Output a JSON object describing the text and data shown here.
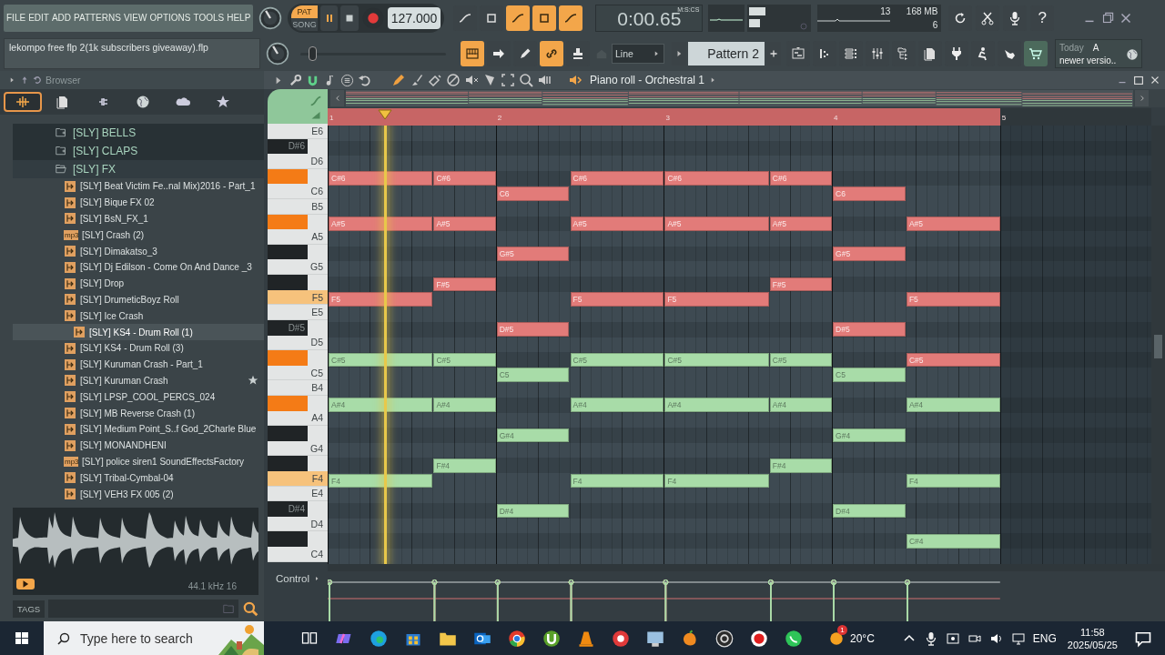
{
  "menu": [
    "FILE",
    "EDIT",
    "ADD",
    "PATTERNS",
    "VIEW",
    "OPTIONS",
    "TOOLS",
    "HELP"
  ],
  "project_title": "lekompo free flp 2(1k subscribers giveaway).flp",
  "transport": {
    "modes": [
      {
        "label": "PAT",
        "selected": true
      },
      {
        "label": "SONG",
        "selected": false
      }
    ],
    "tempo": "127.000"
  },
  "time_display": {
    "value": "0:00.65",
    "format": "M:S:CS"
  },
  "monitor": {
    "cpu": "13",
    "memory": "168 MB",
    "polyphony": "6"
  },
  "help_button": "?",
  "master_pitch": {
    "level": 0.08
  },
  "snap": "Line",
  "pattern": "Pattern 2",
  "news": {
    "date": "Today",
    "lines": [
      "A",
      "newer versio.."
    ]
  },
  "browser": {
    "title": "Browser",
    "tabs": [
      {
        "kind": "all",
        "selected": true
      },
      {
        "kind": "files",
        "selected": false
      },
      {
        "kind": "plugins",
        "selected": false
      },
      {
        "kind": "world",
        "selected": false
      },
      {
        "kind": "cloud",
        "selected": false
      },
      {
        "kind": "favorites",
        "selected": false
      }
    ],
    "tree": [
      {
        "label": "[SLY] BELLS",
        "expanded": false
      },
      {
        "label": "[SLY] CLAPS",
        "expanded": false
      },
      {
        "label": "[SLY] FX",
        "expanded": true,
        "children": [
          {
            "label": "[SLY] Beat Victim Fe..nal Mix)2016 - Part_1",
            "kind": "wav",
            "selected": false,
            "starred": false
          },
          {
            "label": "[SLY] Bique FX 02",
            "kind": "wav",
            "selected": false,
            "starred": false
          },
          {
            "label": "[SLY] BsN_FX_1",
            "kind": "wav",
            "selected": false,
            "starred": false
          },
          {
            "label": "[SLY] Crash (2)",
            "kind": "mp3",
            "badge": "mp3",
            "selected": false,
            "starred": false
          },
          {
            "label": "[SLY] Dimakatso_3",
            "kind": "wav",
            "selected": false,
            "starred": false
          },
          {
            "label": "[SLY] Dj Edilson - Come On And Dance _3",
            "kind": "wav",
            "selected": false,
            "starred": false
          },
          {
            "label": "[SLY] Drop",
            "kind": "wav",
            "selected": false,
            "starred": false
          },
          {
            "label": "[SLY] DrumeticBoyz Roll",
            "kind": "wav",
            "selected": false,
            "starred": false
          },
          {
            "label": "[SLY] Ice Crash",
            "kind": "wav",
            "selected": false,
            "starred": false
          },
          {
            "label": "[SLY] KS4 - Drum Roll (1)",
            "kind": "wav",
            "selected": true,
            "starred": false
          },
          {
            "label": "[SLY] KS4 - Drum Roll (3)",
            "kind": "wav",
            "selected": false,
            "starred": false
          },
          {
            "label": "[SLY] Kuruman Crash - Part_1",
            "kind": "wav",
            "selected": false,
            "starred": false
          },
          {
            "label": "[SLY] Kuruman Crash",
            "kind": "wav",
            "selected": false,
            "starred": true
          },
          {
            "label": "[SLY] LPSP_COOL_PERCS_024",
            "kind": "wav",
            "selected": false,
            "starred": false
          },
          {
            "label": "[SLY] MB Reverse Crash (1)",
            "kind": "wav",
            "selected": false,
            "starred": false
          },
          {
            "label": "[SLY] Medium Point_S..f God_2Charle Blue",
            "kind": "wav",
            "selected": false,
            "starred": false
          },
          {
            "label": "[SLY] MONANDHENI",
            "kind": "wav",
            "selected": false,
            "starred": false
          },
          {
            "label": "[SLY] police siren1 SoundEffectsFactory",
            "kind": "mp3",
            "badge": "mp3",
            "selected": false,
            "starred": false
          },
          {
            "label": "[SLY] Tribal-Cymbal-04",
            "kind": "wav",
            "selected": false,
            "starred": false
          },
          {
            "label": "[SLY] VEH3 FX 005 (2)",
            "kind": "wav",
            "selected": false,
            "starred": false
          }
        ]
      }
    ],
    "preview_info": "44.1 kHz 16",
    "tags_label": "TAGS"
  },
  "piano_roll": {
    "title": "Piano roll - Orchestral 1",
    "bars": [
      "1",
      "2",
      "3",
      "4",
      "5"
    ],
    "playhead": {
      "level": 0.085
    },
    "control_label": "Control",
    "rows": [
      {
        "key": "E6",
        "kind": "white",
        "highlighted": false
      },
      {
        "key": "D#6",
        "kind": "black",
        "highlighted": false
      },
      {
        "key": "D6",
        "kind": "white",
        "highlighted": false
      },
      {
        "kind": "black",
        "highlighted": true,
        "segments": [
          {
            "kind": "long",
            "label": "C#6",
            "color": "#e27b79"
          },
          {
            "kind": "short",
            "label": "C#6",
            "color": "#e27b79"
          },
          {
            "kind": "medium"
          },
          {
            "kind": "wide",
            "label": "C#6",
            "color": "#e27b79"
          },
          {
            "kind": "long",
            "label": "C#6",
            "color": "#e27b79"
          },
          {
            "kind": "short",
            "label": "C#6",
            "color": "#e27b79"
          }
        ]
      },
      {
        "key": "C6",
        "kind": "white",
        "highlighted": false,
        "segments": [
          {
            "kind": "bar"
          },
          {
            "kind": "medium",
            "label": "C6",
            "color": "#e27b79"
          },
          {
            "kind": "wide"
          },
          {
            "kind": "bar"
          },
          {
            "kind": "medium",
            "label": "C6",
            "color": "#e27b79"
          }
        ]
      },
      {
        "key": "B5",
        "kind": "white",
        "highlighted": false
      },
      {
        "kind": "black",
        "highlighted": true,
        "segments": [
          {
            "kind": "long",
            "label": "A#5",
            "color": "#e27b79"
          },
          {
            "kind": "short",
            "label": "A#5",
            "color": "#e27b79"
          },
          {
            "kind": "medium"
          },
          {
            "kind": "wide",
            "label": "A#5",
            "color": "#e27b79"
          },
          {
            "kind": "long",
            "label": "A#5",
            "color": "#e27b79"
          },
          {
            "kind": "short",
            "label": "A#5",
            "color": "#e27b79"
          },
          {
            "kind": "medium"
          },
          {
            "kind": "wide",
            "label": "A#5",
            "color": "#e27b79"
          }
        ]
      },
      {
        "key": "A5",
        "kind": "white",
        "highlighted": false
      },
      {
        "kind": "black",
        "highlighted": false,
        "segments": [
          {
            "kind": "bar"
          },
          {
            "kind": "medium",
            "label": "G#5",
            "color": "#e27b79"
          },
          {
            "kind": "wide"
          },
          {
            "kind": "bar"
          },
          {
            "kind": "medium",
            "label": "G#5",
            "color": "#e27b79"
          }
        ]
      },
      {
        "key": "G5",
        "kind": "white",
        "highlighted": false
      },
      {
        "kind": "black",
        "highlighted": false,
        "segments": [
          {
            "kind": "long"
          },
          {
            "kind": "short",
            "label": "F#5",
            "color": "#e27b79"
          },
          {
            "kind": "bar"
          },
          {
            "kind": "long"
          },
          {
            "kind": "short",
            "label": "F#5",
            "color": "#e27b79"
          }
        ]
      },
      {
        "key": "F5",
        "kind": "white",
        "highlighted": true,
        "segments": [
          {
            "kind": "long",
            "label": "F5",
            "color": "#e27b79"
          },
          {
            "kind": "short"
          },
          {
            "kind": "medium"
          },
          {
            "kind": "wide",
            "label": "F5",
            "color": "#e27b79"
          },
          {
            "kind": "long",
            "label": "F5",
            "color": "#e27b79"
          },
          {
            "kind": "short"
          },
          {
            "kind": "medium"
          },
          {
            "kind": "wide",
            "label": "F5",
            "color": "#e27b79"
          }
        ]
      },
      {
        "key": "E5",
        "kind": "white",
        "highlighted": false
      },
      {
        "key": "D#5",
        "kind": "black",
        "highlighted": false,
        "segments": [
          {
            "kind": "bar"
          },
          {
            "kind": "medium",
            "label": "D#5",
            "color": "#e27b79"
          },
          {
            "kind": "wide"
          },
          {
            "kind": "bar"
          },
          {
            "kind": "medium",
            "label": "D#5",
            "color": "#e27b79"
          }
        ]
      },
      {
        "key": "D5",
        "kind": "white",
        "highlighted": false
      },
      {
        "kind": "black",
        "highlighted": true,
        "segments": [
          {
            "kind": "long",
            "label": "C#5",
            "color": "#a8dca8"
          },
          {
            "kind": "short",
            "label": "C#5",
            "color": "#a8dca8"
          },
          {
            "kind": "medium"
          },
          {
            "kind": "wide",
            "label": "C#5",
            "color": "#a8dca8"
          },
          {
            "kind": "long",
            "label": "C#5",
            "color": "#a8dca8"
          },
          {
            "kind": "short",
            "label": "C#5",
            "color": "#a8dca8"
          },
          {
            "kind": "medium"
          },
          {
            "kind": "wide",
            "label": "C#5",
            "color": "#e27b79"
          }
        ]
      },
      {
        "key": "C5",
        "kind": "white",
        "highlighted": false,
        "segments": [
          {
            "kind": "bar"
          },
          {
            "kind": "medium",
            "label": "C5",
            "color": "#a8dca8"
          },
          {
            "kind": "wide"
          },
          {
            "kind": "bar"
          },
          {
            "kind": "medium",
            "label": "C5",
            "color": "#a8dca8"
          }
        ]
      },
      {
        "key": "B4",
        "kind": "white",
        "highlighted": false
      },
      {
        "kind": "black",
        "highlighted": true,
        "segments": [
          {
            "kind": "long",
            "label": "A#4",
            "color": "#a8dca8"
          },
          {
            "kind": "short",
            "label": "A#4",
            "color": "#a8dca8"
          },
          {
            "kind": "medium"
          },
          {
            "kind": "wide",
            "label": "A#4",
            "color": "#a8dca8"
          },
          {
            "kind": "long",
            "label": "A#4",
            "color": "#a8dca8"
          },
          {
            "kind": "short",
            "label": "A#4",
            "color": "#a8dca8"
          },
          {
            "kind": "medium"
          },
          {
            "kind": "wide",
            "label": "A#4",
            "color": "#a8dca8"
          }
        ]
      },
      {
        "key": "A4",
        "kind": "white",
        "highlighted": false
      },
      {
        "kind": "black",
        "highlighted": false,
        "segments": [
          {
            "kind": "bar"
          },
          {
            "kind": "medium",
            "label": "G#4",
            "color": "#a8dca8"
          },
          {
            "kind": "wide"
          },
          {
            "kind": "bar"
          },
          {
            "kind": "medium",
            "label": "G#4",
            "color": "#a8dca8"
          }
        ]
      },
      {
        "key": "G4",
        "kind": "white",
        "highlighted": false
      },
      {
        "kind": "black",
        "highlighted": false,
        "segments": [
          {
            "kind": "long"
          },
          {
            "kind": "short",
            "label": "F#4",
            "color": "#a8dca8"
          },
          {
            "kind": "bar"
          },
          {
            "kind": "long"
          },
          {
            "kind": "short",
            "label": "F#4",
            "color": "#a8dca8"
          }
        ]
      },
      {
        "key": "F4",
        "kind": "white",
        "highlighted": true,
        "segments": [
          {
            "kind": "long",
            "label": "F4",
            "color": "#a8dca8"
          },
          {
            "kind": "short"
          },
          {
            "kind": "medium"
          },
          {
            "kind": "wide",
            "label": "F4",
            "color": "#a8dca8"
          },
          {
            "kind": "long",
            "label": "F4",
            "color": "#a8dca8"
          },
          {
            "kind": "short"
          },
          {
            "kind": "medium"
          },
          {
            "kind": "wide",
            "label": "F4",
            "color": "#a8dca8"
          }
        ]
      },
      {
        "key": "E4",
        "kind": "white",
        "highlighted": false
      },
      {
        "key": "D#4",
        "kind": "black",
        "highlighted": false,
        "segments": [
          {
            "kind": "bar"
          },
          {
            "kind": "medium",
            "label": "D#4",
            "color": "#a8dca8"
          },
          {
            "kind": "wide"
          },
          {
            "kind": "bar"
          },
          {
            "kind": "medium",
            "label": "D#4",
            "color": "#a8dca8"
          }
        ]
      },
      {
        "key": "D4",
        "kind": "white",
        "highlighted": false
      },
      {
        "kind": "black",
        "highlighted": false,
        "segments": [
          {
            "kind": "bar"
          },
          {
            "kind": "bar"
          },
          {
            "kind": "bar"
          },
          {
            "kind": "medium"
          },
          {
            "kind": "wide",
            "label": "C#4",
            "color": "#a8dca8"
          }
        ]
      },
      {
        "key": "C4",
        "kind": "white",
        "highlighted": false
      }
    ]
  },
  "taskbar": {
    "search_placeholder": "Type here to search",
    "weather": {
      "temperature": "20°C",
      "badge": "1"
    },
    "language": "ENG",
    "time": "11:58",
    "date": "2025/05/25"
  }
}
